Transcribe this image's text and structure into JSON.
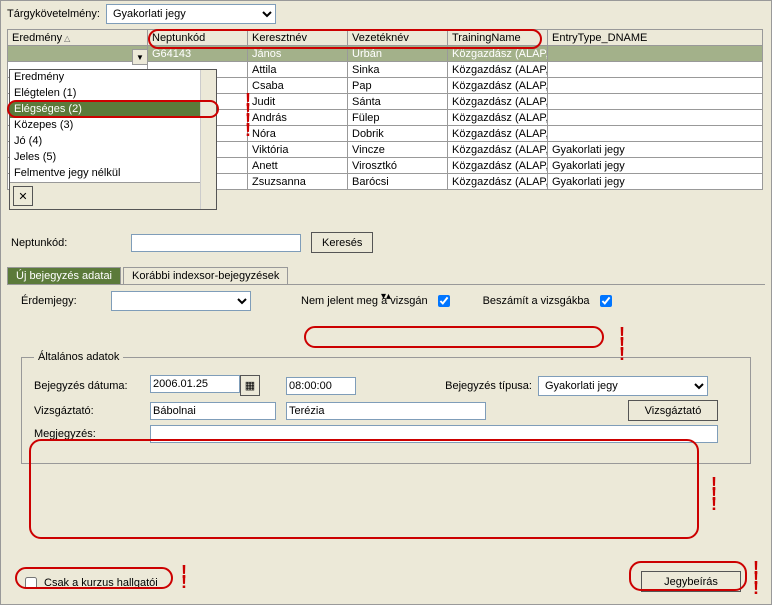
{
  "top": {
    "req_label": "Tárgykövetelmény:",
    "req_value": "Gyakorlati jegy"
  },
  "columns": {
    "c1": "Eredmény",
    "c2": "Neptunkód",
    "c3": "Keresztnév",
    "c4": "Vezetéknév",
    "c5": "TrainingName",
    "c6": "EntryType_DNAME"
  },
  "rows": [
    {
      "nep": "G64143",
      "first": "János",
      "last": "Urbán",
      "train": "Közgazdász (ALAP,N",
      "entry": ""
    },
    {
      "nep": "",
      "first": "Attila",
      "last": "Sinka",
      "train": "Közgazdász (ALAP,N",
      "entry": ""
    },
    {
      "nep": "",
      "first": "Csaba",
      "last": "Pap",
      "train": "Közgazdász (ALAP,N",
      "entry": ""
    },
    {
      "nep": "",
      "first": "Judit",
      "last": "Sánta",
      "train": "Közgazdász (ALAP,N",
      "entry": ""
    },
    {
      "nep": "",
      "first": "András",
      "last": "Fülep",
      "train": "Közgazdász (ALAP,N",
      "entry": ""
    },
    {
      "nep": "",
      "first": "Nóra",
      "last": "Dobrik",
      "train": "Közgazdász (ALAP,N",
      "entry": ""
    },
    {
      "nep": "",
      "first": "Viktória",
      "last": "Vincze",
      "train": "Közgazdász (ALAP,N",
      "entry": "Gyakorlati jegy"
    },
    {
      "nep": "",
      "first": "Anett",
      "last": "Virosztkó",
      "train": "Közgazdász (ALAP,N",
      "entry": "Gyakorlati jegy"
    },
    {
      "nep": "",
      "first": "Zsuzsanna",
      "last": "Barócsi",
      "train": "Közgazdász (ALAP,N",
      "entry": "Gyakorlati jegy"
    }
  ],
  "ered_options": [
    "Eredmény",
    "Elégtelen (1)",
    "Elégséges (2)",
    "Közepes (3)",
    "Jó (4)",
    "Jeles (5)",
    "Felmentve jegy nélkül"
  ],
  "search": {
    "label": "Neptunkód:",
    "value": "",
    "button": "Keresés"
  },
  "tabs": {
    "t1": "Új bejegyzés adatai",
    "t2": "Korábbi indexsor-bejegyzések"
  },
  "form": {
    "grade_label": "Érdemjegy:",
    "noshow_label": "Nem jelent meg a vizsgán",
    "counts_label": "Beszámít a vizsgákba",
    "fieldset": "Általános adatok",
    "date_label": "Bejegyzés dátuma:",
    "date": "2006.01.25",
    "time": "08:00:00",
    "type_label": "Bejegyzés típusa:",
    "type_value": "Gyakorlati jegy",
    "examiner_label": "Vizsgáztató:",
    "examiner_first": "Bábolnai",
    "examiner_last": "Terézia",
    "examiner_btn": "Vizsgáztató",
    "note_label": "Megjegyzés:",
    "note_value": ""
  },
  "footer": {
    "only_course": "Csak a kurzus hallgatói",
    "write_btn": "Jegybeírás"
  }
}
